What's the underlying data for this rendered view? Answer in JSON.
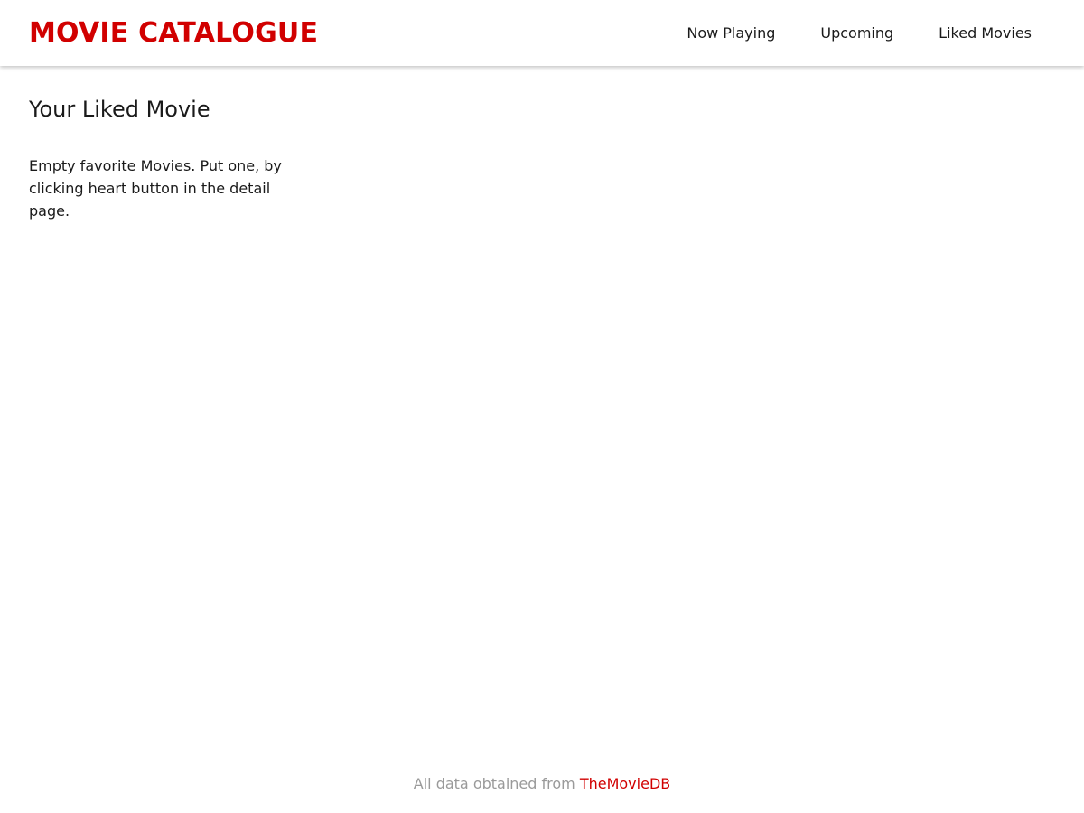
{
  "colors": {
    "brand": "#d10000",
    "text": "#1a1a1a",
    "muted": "#9a9a9a"
  },
  "header": {
    "brand": "MOVIE CATALOGUE",
    "nav": [
      {
        "label": "Now Playing"
      },
      {
        "label": "Upcoming"
      },
      {
        "label": "Liked Movies"
      }
    ]
  },
  "main": {
    "title": "Your Liked Movie",
    "empty_message": "Empty favorite Movies. Put one, by clicking heart button in the detail page."
  },
  "footer": {
    "prefix": "All data obtained from",
    "link": "TheMovieDB"
  }
}
